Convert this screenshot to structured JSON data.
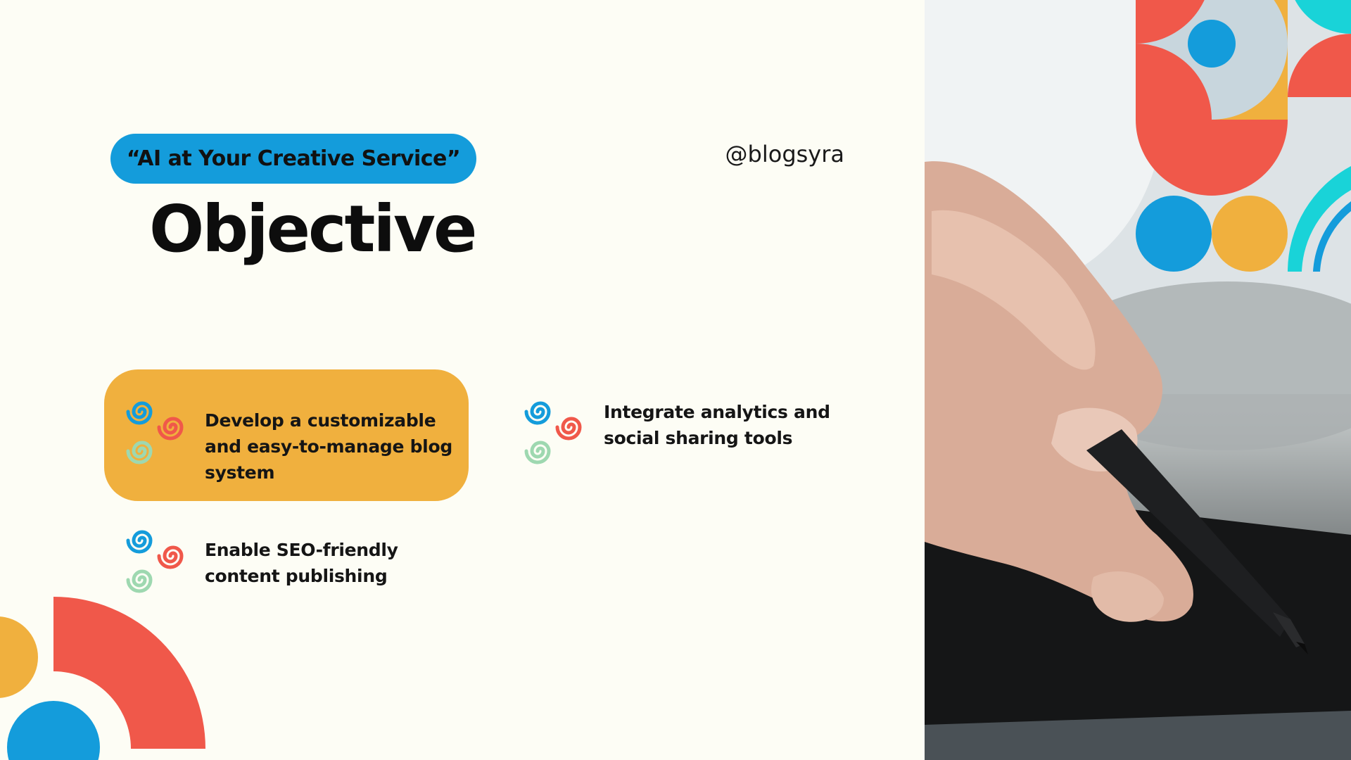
{
  "slide": {
    "tagline": "“AI at Your Creative Service”",
    "handle": "@blogsyra",
    "title": "Objective",
    "items": [
      {
        "text_lines": [
          "Develop a customizable",
          "and easy-to-manage blog",
          "system"
        ],
        "highlighted": true,
        "icon": "swirl-cluster-icon"
      },
      {
        "text_lines": [
          "Integrate analytics and",
          "social sharing tools"
        ],
        "highlighted": false,
        "icon": "swirl-cluster-icon"
      },
      {
        "text_lines": [
          "Enable SEO-friendly",
          "content publishing"
        ],
        "highlighted": false,
        "icon": "swirl-cluster-icon"
      }
    ]
  },
  "colors": {
    "background": "#FDFDF5",
    "blue": "#149CDB",
    "orange": "#F0B03E",
    "coral": "#F0584A",
    "teal": "#19D3D8",
    "mint": "#9ED8B0"
  }
}
